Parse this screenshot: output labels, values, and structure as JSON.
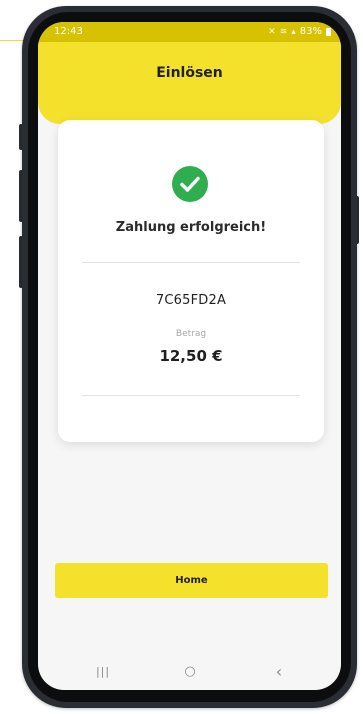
{
  "status_bar": {
    "time": "12:43",
    "icons": [
      "mute-icon",
      "wifi-icon",
      "signal-icon"
    ],
    "battery": "83%"
  },
  "header": {
    "title": "Einlösen"
  },
  "card": {
    "icon": "check-circle-icon",
    "success_message": "Zahlung erfolgreich!",
    "code": "7C65FD2A",
    "amount_label": "Betrag",
    "amount_value": "12,50 €"
  },
  "actions": {
    "home_label": "Home"
  },
  "nav_bar": {
    "items": [
      {
        "name": "recent-apps-icon",
        "glyph": "|||"
      },
      {
        "name": "home-circle-icon",
        "glyph": "○"
      },
      {
        "name": "back-icon",
        "glyph": "‹"
      }
    ]
  },
  "colors": {
    "accent_yellow": "#f4e12c",
    "success_green": "#2eae4e",
    "status_bar": "#d6c200"
  }
}
